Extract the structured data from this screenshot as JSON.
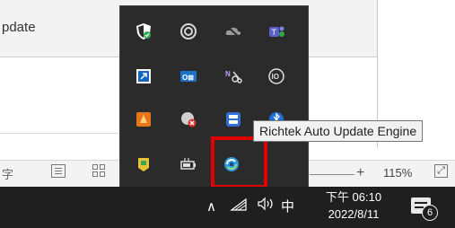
{
  "app": {
    "panel_title": "pdate",
    "status_left_glyph": "字",
    "zoom_plus": "+",
    "zoom_percent": "115%",
    "fit_glyph": "⤢"
  },
  "flyout": {
    "icons": [
      {
        "name": "windows-security-shield-icon"
      },
      {
        "name": "spiral-app-icon"
      },
      {
        "name": "cloud-offline-icon"
      },
      {
        "name": "teams-icon"
      },
      {
        "name": "remote-desktop-icon"
      },
      {
        "name": "outlook-icon"
      },
      {
        "name": "snipping-tool-icon"
      },
      {
        "name": "io-app-icon"
      },
      {
        "name": "orange-app-icon"
      },
      {
        "name": "blocked-app-icon"
      },
      {
        "name": "window-manager-icon"
      },
      {
        "name": "bluetooth-icon"
      },
      {
        "name": "usb-device-icon"
      },
      {
        "name": "battery-icon"
      },
      {
        "name": "richtek-update-engine-icon"
      }
    ],
    "tooltip": "Richtek Auto Update Engine",
    "highlight_color": "#e00000"
  },
  "taskbar": {
    "chevron": "∧",
    "wifi": "◠",
    "volume": "🔈",
    "ime": "中",
    "time": "下午 06:10",
    "date": "2022/8/11",
    "notification_count": "6"
  }
}
